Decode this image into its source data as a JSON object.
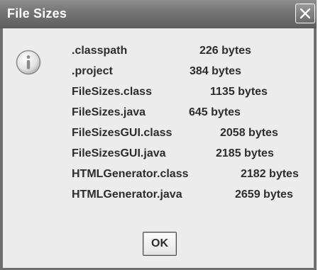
{
  "window": {
    "title": "File Sizes",
    "close_icon": "close-icon"
  },
  "message": {
    "icon": "info-icon",
    "files": [
      {
        "name": ".classpath",
        "size": "226 bytes"
      },
      {
        "name": ".project",
        "size": "384 bytes"
      },
      {
        "name": "FileSizes.class",
        "size": "1135 bytes"
      },
      {
        "name": "FileSizes.java",
        "size": "645 bytes"
      },
      {
        "name": "FileSizesGUI.class",
        "size": "2058 bytes"
      },
      {
        "name": "FileSizesGUI.java",
        "size": "2185 bytes"
      },
      {
        "name": "HTMLGenerator.class",
        "size": "2182 bytes"
      },
      {
        "name": "HTMLGenerator.java",
        "size": "2659 bytes"
      }
    ]
  },
  "buttons": {
    "ok_label": "OK"
  },
  "colors": {
    "titlebar": "#767676",
    "body": "#ececec",
    "text": "#2d2d2d"
  }
}
